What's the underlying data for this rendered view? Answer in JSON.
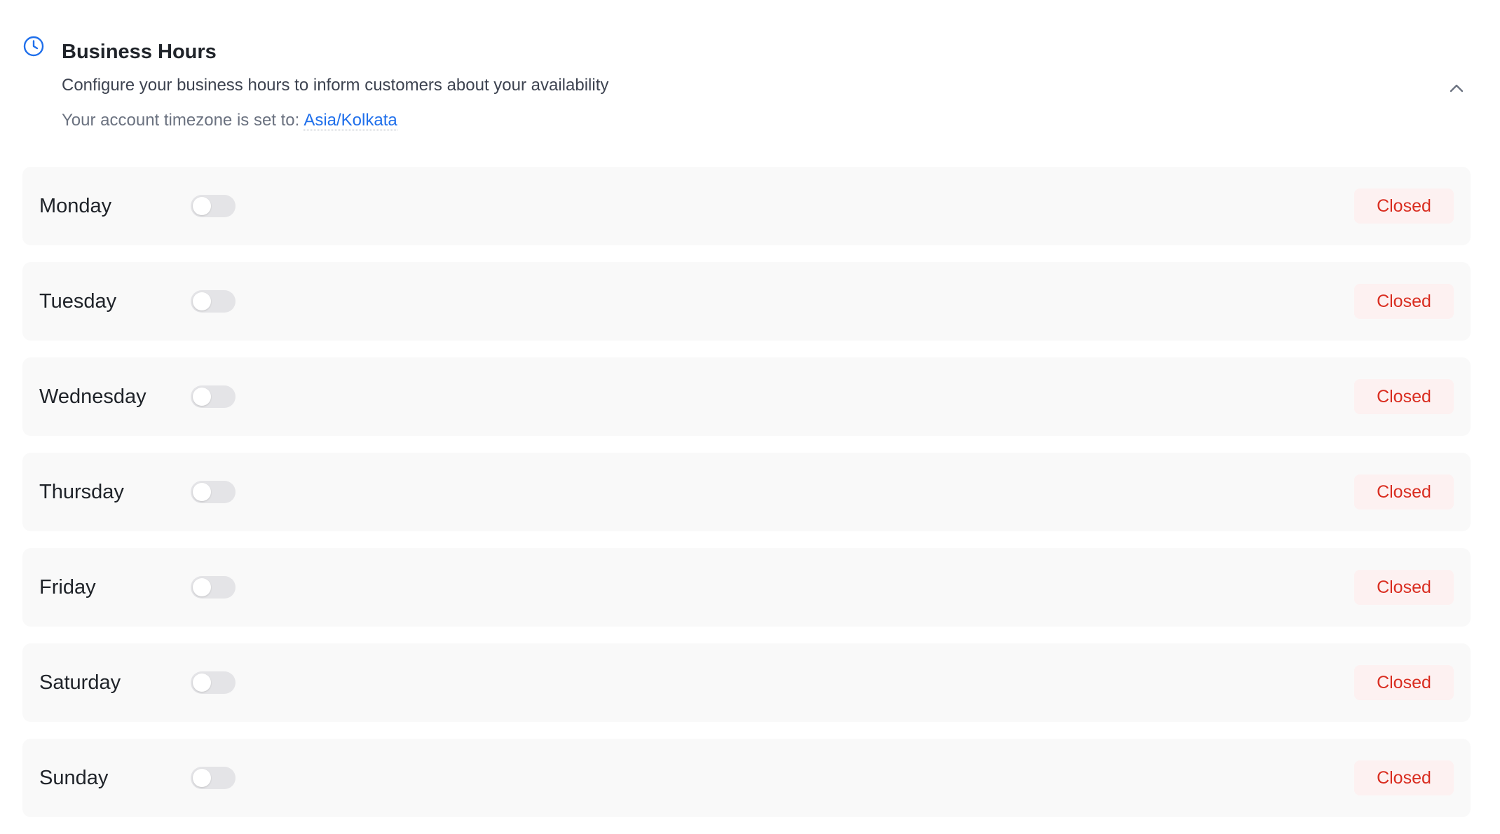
{
  "header": {
    "title": "Business Hours",
    "subtitle": "Configure your business hours to inform customers about your availability",
    "timezone_label": "Your account timezone is set to:",
    "timezone_value": "Asia/Kolkata",
    "icon": "clock-icon",
    "collapse_icon": "chevron-up-icon"
  },
  "colors": {
    "accent": "#1f6feb",
    "closed_text": "#d92d20",
    "closed_bg": "#fdf1f1",
    "row_bg": "#f9f9f9"
  },
  "days": [
    {
      "label": "Monday",
      "enabled": false,
      "status": "Closed"
    },
    {
      "label": "Tuesday",
      "enabled": false,
      "status": "Closed"
    },
    {
      "label": "Wednesday",
      "enabled": false,
      "status": "Closed"
    },
    {
      "label": "Thursday",
      "enabled": false,
      "status": "Closed"
    },
    {
      "label": "Friday",
      "enabled": false,
      "status": "Closed"
    },
    {
      "label": "Saturday",
      "enabled": false,
      "status": "Closed"
    },
    {
      "label": "Sunday",
      "enabled": false,
      "status": "Closed"
    }
  ]
}
